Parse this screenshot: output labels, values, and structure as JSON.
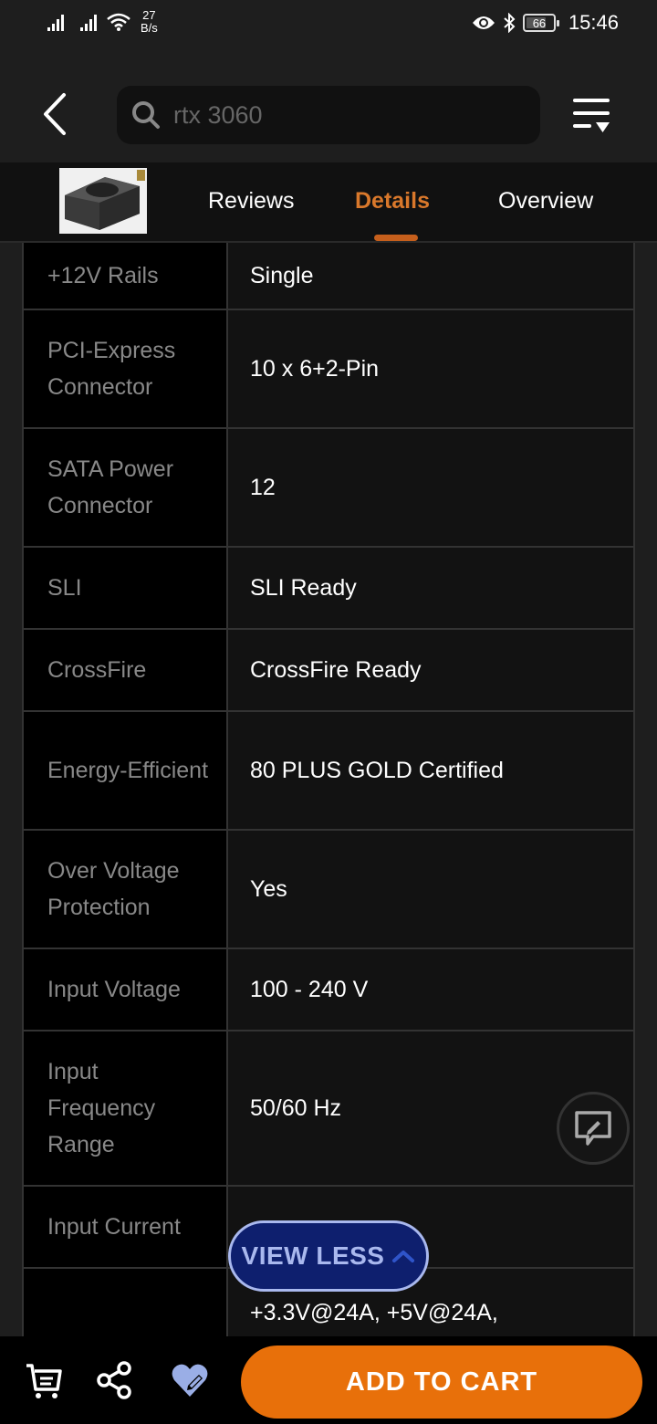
{
  "status_bar": {
    "net_speed_value": "27",
    "net_speed_unit": "B/s",
    "battery": "66",
    "time": "15:46"
  },
  "header": {
    "search": {
      "value": "rtx 3060"
    }
  },
  "tabs": [
    {
      "label": "Reviews",
      "active": false
    },
    {
      "label": "Details",
      "active": true
    },
    {
      "label": "Overview",
      "active": false
    }
  ],
  "colors": {
    "accent_orange": "#e8700a",
    "active_tab": "#d9782b",
    "view_less_bg": "#0e1f6e",
    "view_less_text": "#a9b8ee"
  },
  "specs": [
    {
      "key": "+12V Rails",
      "value": "Single"
    },
    {
      "key": "PCI-Express Connector",
      "value": "10 x 6+2-Pin"
    },
    {
      "key": "SATA Power Connector",
      "value": "12"
    },
    {
      "key": "SLI",
      "value": "SLI Ready"
    },
    {
      "key": "CrossFire",
      "value": "CrossFire Ready"
    },
    {
      "key": "Energy-Efficient",
      "value": "80 PLUS GOLD Certified"
    },
    {
      "key": "Over Voltage Protection",
      "value": "Yes"
    },
    {
      "key": "Input Voltage",
      "value": "100 - 240 V"
    },
    {
      "key": "Input Frequency Range",
      "value": "50/60 Hz"
    },
    {
      "key": "Input Current",
      "value": ""
    },
    {
      "key": "",
      "value": "+3.3V@24A, +5V@24A,"
    }
  ],
  "view_less_label": "VIEW LESS",
  "bottom_bar": {
    "add_to_cart_label": "ADD TO CART"
  }
}
